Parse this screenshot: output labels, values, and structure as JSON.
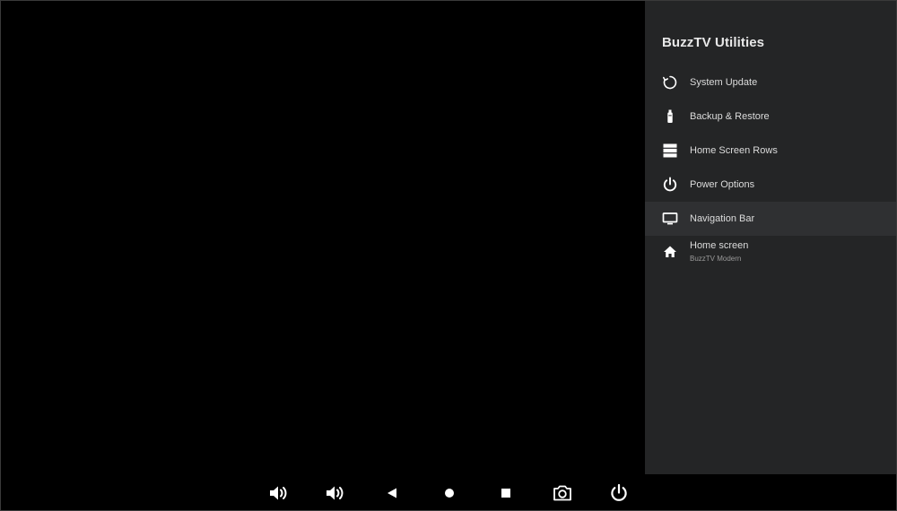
{
  "panel": {
    "title": "BuzzTV Utilities",
    "items": [
      {
        "label": "System Update",
        "icon": "sync-icon"
      },
      {
        "label": "Backup & Restore",
        "icon": "usb-icon"
      },
      {
        "label": "Home Screen Rows",
        "icon": "rows-icon"
      },
      {
        "label": "Power Options",
        "icon": "power-icon"
      },
      {
        "label": "Navigation Bar",
        "icon": "monitor-icon"
      },
      {
        "label": "Home screen",
        "sublabel": "BuzzTV Modern",
        "icon": "home-icon"
      }
    ]
  },
  "navbar": {
    "buttons": [
      {
        "name": "volume-down-button",
        "icon": "volume-down-icon"
      },
      {
        "name": "volume-up-button",
        "icon": "volume-up-icon"
      },
      {
        "name": "back-button",
        "icon": "back-triangle-icon"
      },
      {
        "name": "home-button",
        "icon": "home-circle-icon"
      },
      {
        "name": "recents-button",
        "icon": "recents-square-icon"
      },
      {
        "name": "screenshot-button",
        "icon": "camera-icon"
      },
      {
        "name": "power-button",
        "icon": "power-icon"
      }
    ]
  },
  "colors": {
    "panel_bg": "#242526",
    "highlight_bg": "#2f3032",
    "text": "#dcdcdc",
    "subtext": "#9a9a9a",
    "icon": "#ffffff"
  }
}
